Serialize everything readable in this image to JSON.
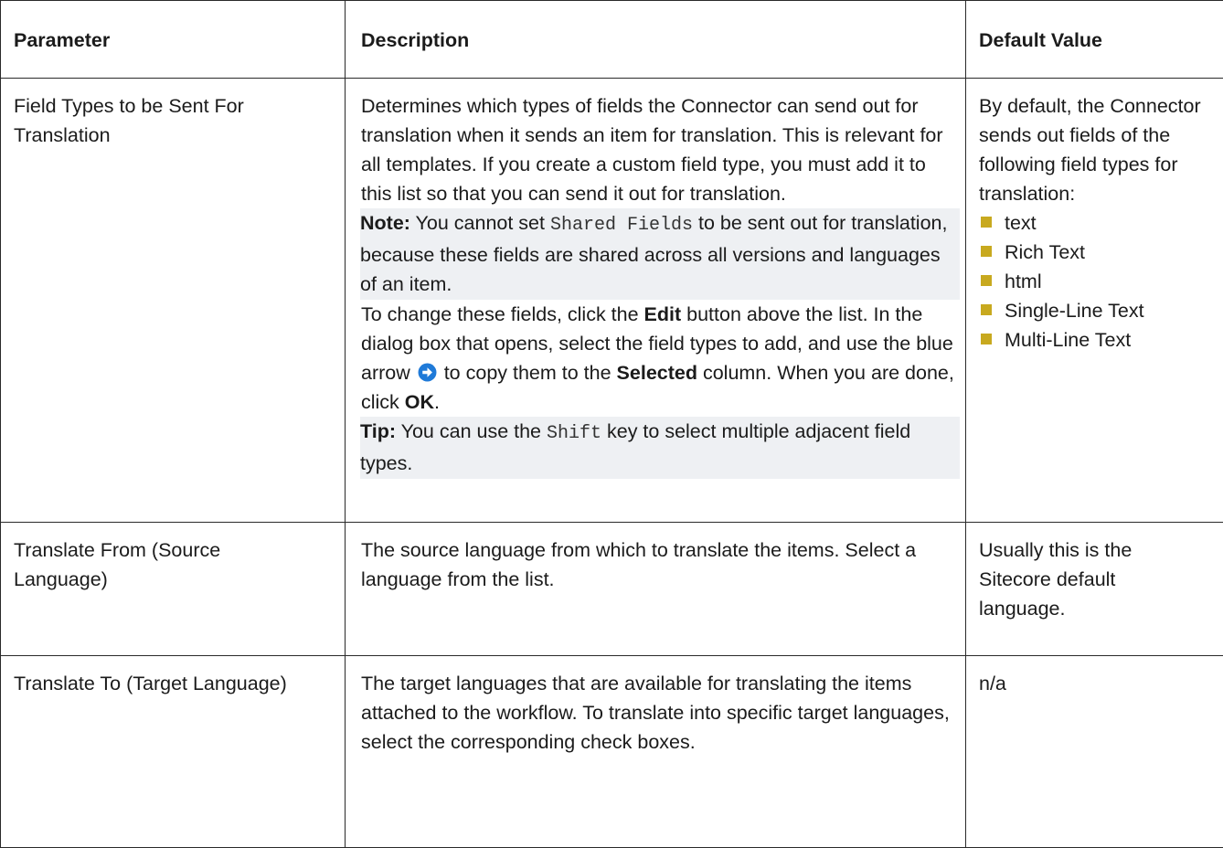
{
  "header": {
    "parameter": "Parameter",
    "description": "Description",
    "default_value": "Default Value"
  },
  "rows": [
    {
      "parameter": "Field Types to be Sent For Translation",
      "description": {
        "intro": "Determines which types of fields the Connector can send out for translation when it sends an item for translation. This is relevant for all templates. If you create a custom field type, you must add it to this list so that you can send it out for translation.",
        "note_label": "Note:",
        "note_pre": " You cannot set ",
        "note_code": "Shared Fields",
        "note_post": " to be sent out for translation, because these fields are shared across all versions and languages of an item.",
        "change_pre": "To change these fields, click the ",
        "change_edit": "Edit",
        "change_mid": " button above the list. In the dialog box that opens, select the field types to add, and use the blue arrow ",
        "change_after_arrow": " to copy them to the ",
        "change_selected": "Selected",
        "change_post": " column. When you are done, click ",
        "change_ok": "OK",
        "change_end": ".",
        "tip_label": "Tip:",
        "tip_pre": " You can use the ",
        "tip_code": "Shift",
        "tip_post": " key to select multiple adjacent field types."
      },
      "default": {
        "intro": "By default, the Connector sends out fields of the following field types for translation:",
        "items": [
          "text",
          "Rich Text",
          "html",
          "Single-Line Text",
          "Multi-Line Text"
        ]
      }
    },
    {
      "parameter": "Translate From (Source Language)",
      "description": "The source language from which to translate the items. Select a language from the list.",
      "default": "Usually this is the Sitecore default language."
    },
    {
      "parameter": "Translate To (Target Language)",
      "description": "The target languages that are available for translating the items attached to the workflow. To translate into specific target languages, select the corresponding check boxes.",
      "default": "n/a"
    }
  ],
  "icons": {
    "arrow": "blue-arrow-right-icon",
    "bullet": "square-bullet-icon"
  },
  "colors": {
    "arrow": "#1f7ad8",
    "bullet": "#c8a91f",
    "note_bg": "#eef0f3"
  }
}
